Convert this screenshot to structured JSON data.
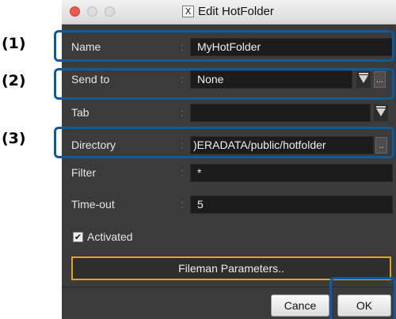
{
  "window": {
    "title": "Edit HotFolder",
    "app_icon": "X"
  },
  "form": {
    "name": {
      "label": "Name",
      "value": "MyHotFolder"
    },
    "send_to": {
      "label": "Send to",
      "value": "None",
      "browse": "..."
    },
    "tab": {
      "label": "Tab",
      "value": ""
    },
    "directory": {
      "label": "Directory",
      "value": ")ERADATA/public/hotfolder",
      "browse": ".."
    },
    "filter": {
      "label": "Filter",
      "value": "*"
    },
    "timeout": {
      "label": "Time-out",
      "value": "5"
    },
    "activated": {
      "label": "Activated",
      "checked": true,
      "check_glyph": "✔"
    },
    "colon": ":"
  },
  "buttons": {
    "fileman": "Fileman Parameters..",
    "cancel": "Cance",
    "ok": "OK"
  },
  "callouts": [
    "(1)",
    "(2)",
    "(3)"
  ],
  "colors": {
    "callout_border": "#0d5a9e",
    "fileman_border": "#e2a323",
    "dialog_bg": "#3b3b3b"
  }
}
